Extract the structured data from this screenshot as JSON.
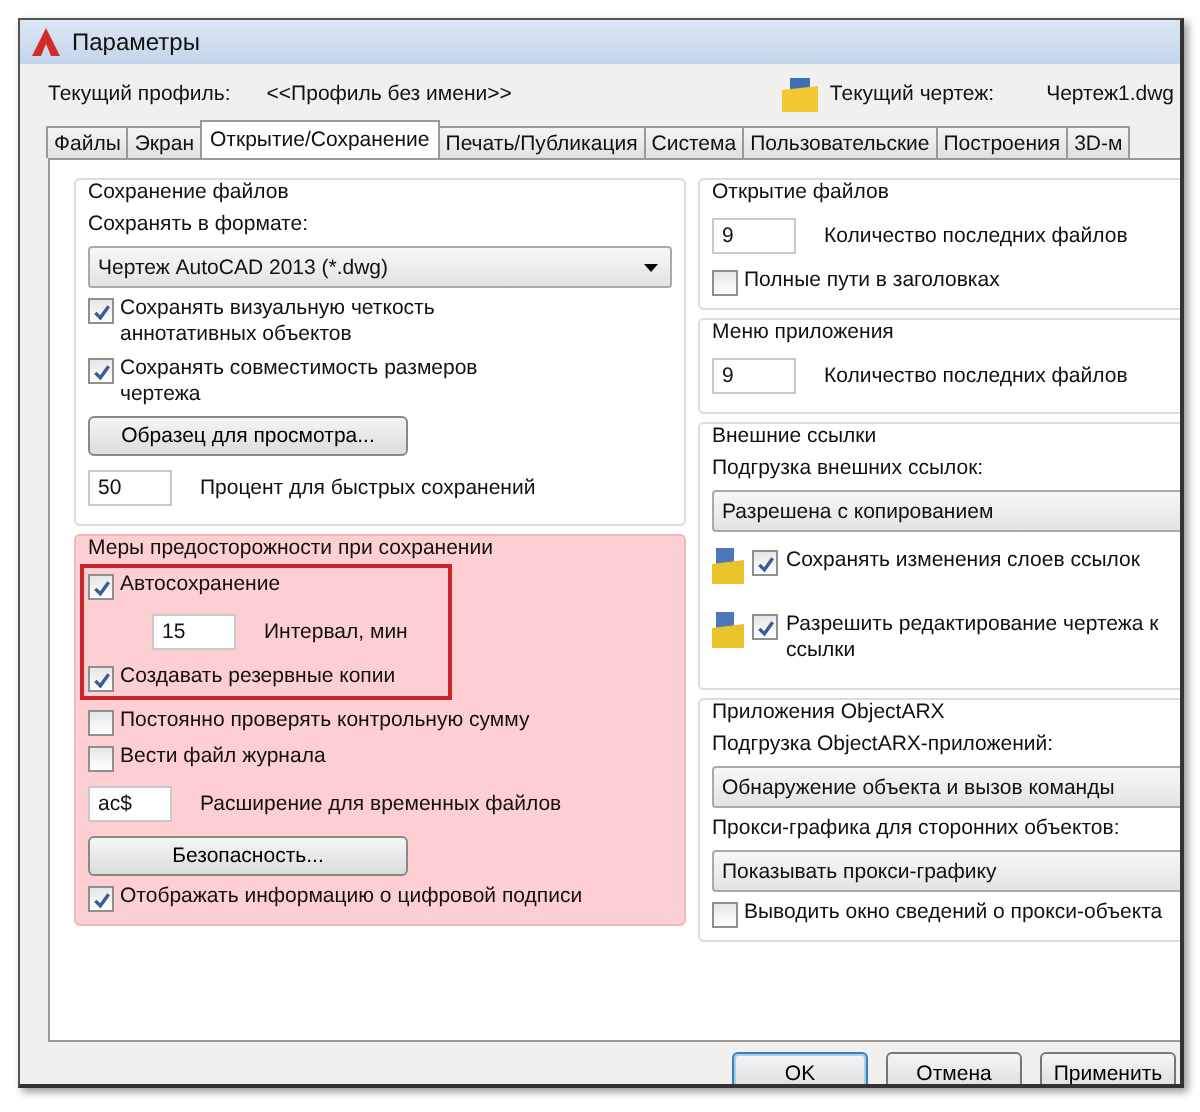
{
  "window": {
    "title": "Параметры"
  },
  "profile": {
    "label": "Текущий профиль:",
    "value": "<<Профиль без имени>>",
    "drawing_label": "Текущий чертеж:",
    "drawing_value": "Чертеж1.dwg"
  },
  "tabs": [
    {
      "label": "Файлы",
      "selected": false
    },
    {
      "label": "Экран",
      "selected": false
    },
    {
      "label": "Открытие/Сохранение",
      "selected": true
    },
    {
      "label": "Печать/Публикация",
      "selected": false
    },
    {
      "label": "Система",
      "selected": false
    },
    {
      "label": "Пользовательские",
      "selected": false
    },
    {
      "label": "Построения",
      "selected": false
    },
    {
      "label": "3D-м",
      "selected": false
    }
  ],
  "left_groups": [
    {
      "title": "Сохранение файлов",
      "highlighted": false,
      "items": [
        {
          "kind": "label",
          "text": "Сохранять в формате:"
        },
        {
          "kind": "select",
          "value": "Чертеж AutoCAD 2013 (*.dwg)"
        },
        {
          "kind": "checkbox",
          "label": "Сохранять визуальную четкость\nаннотативных объектов",
          "checked": true
        },
        {
          "kind": "checkbox",
          "label": "Сохранять совместимость размеров\nчертежа",
          "checked": true
        },
        {
          "kind": "button",
          "label": "Образец для просмотра..."
        },
        {
          "kind": "field",
          "caption": "Процент для быстрых сохранений",
          "value": "50"
        }
      ]
    },
    {
      "title": "Меры предосторожности при сохранении",
      "highlighted": true,
      "framed_items": [
        {
          "kind": "checkbox",
          "label": "Автосохранение",
          "checked": true
        },
        {
          "kind": "subfield",
          "caption": "Интервал, мин",
          "value": "15"
        },
        {
          "kind": "checkbox",
          "label": "Создавать резервные копии",
          "checked": true
        }
      ],
      "items": [
        {
          "kind": "checkbox",
          "label": "Постоянно проверять контрольную сумму",
          "checked": false
        },
        {
          "kind": "checkbox",
          "label": "Вести файл журнала",
          "checked": false
        },
        {
          "kind": "field",
          "caption": "Расширение для временных файлов",
          "value": "ac$"
        },
        {
          "kind": "button",
          "label": "Безопасность..."
        },
        {
          "kind": "checkbox",
          "label": "Отображать информацию о цифровой подписи",
          "checked": true
        }
      ]
    }
  ],
  "right_groups": [
    {
      "title": "Открытие файлов",
      "items": [
        {
          "kind": "field",
          "caption": "Количество последних файлов",
          "value": "9"
        },
        {
          "kind": "checkbox",
          "label": "Полные пути в заголовках",
          "checked": false
        }
      ]
    },
    {
      "title": "Меню приложения",
      "items": [
        {
          "kind": "field",
          "caption": "Количество последних файлов",
          "value": "9"
        }
      ]
    },
    {
      "title": "Внешние ссылки",
      "items": [
        {
          "kind": "label",
          "text": "Подгрузка внешних ссылок:"
        },
        {
          "kind": "select",
          "value": "Разрешена с копированием"
        },
        {
          "kind": "icon_checkbox",
          "label": "Сохранять изменения слоев ссылок",
          "checked": true
        },
        {
          "kind": "icon_checkbox",
          "label": "Разрешить редактирование чертежа к\nссылки",
          "checked": true
        }
      ]
    },
    {
      "title": "Приложения ObjectARX",
      "items": [
        {
          "kind": "label",
          "text": "Подгрузка ObjectARX-приложений:"
        },
        {
          "kind": "select",
          "value": "Обнаружение объекта и вызов команды"
        },
        {
          "kind": "label",
          "text": "Прокси-графика для сторонних объектов:"
        },
        {
          "kind": "select",
          "value": "Показывать прокси-графику"
        },
        {
          "kind": "checkbox",
          "label": "Выводить окно сведений о прокси-объекта",
          "checked": false
        }
      ]
    }
  ],
  "buttons": [
    {
      "label": "OK",
      "default": true
    },
    {
      "label": "Отмена",
      "default": false
    },
    {
      "label": "Применить",
      "default": false
    }
  ]
}
